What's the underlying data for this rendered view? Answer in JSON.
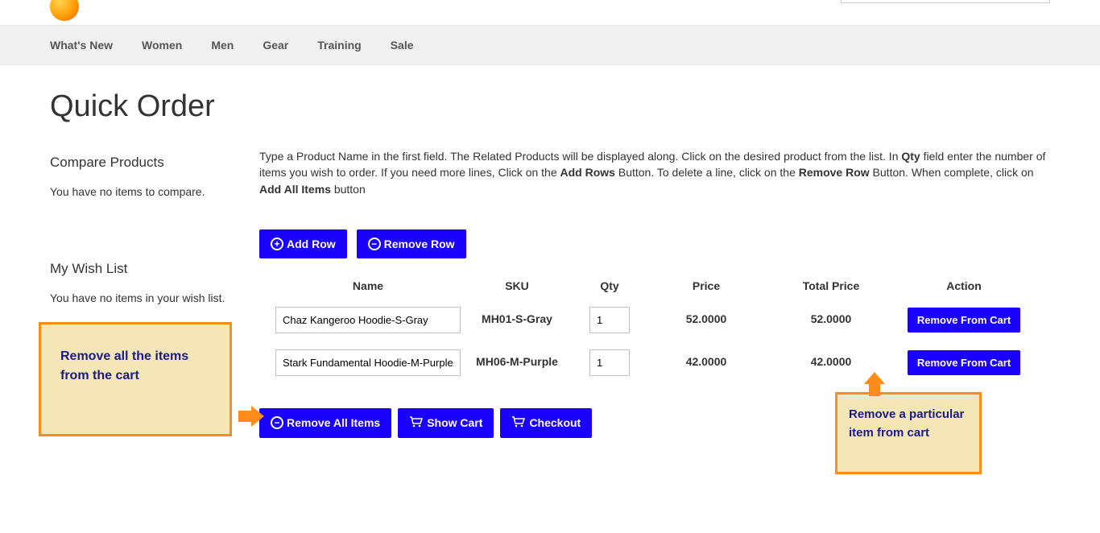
{
  "nav": [
    "What's New",
    "Women",
    "Men",
    "Gear",
    "Training",
    "Sale"
  ],
  "page_title": "Quick Order",
  "sidebar": {
    "compare_title": "Compare Products",
    "compare_empty": "You have no items to compare.",
    "wishlist_title": "My Wish List",
    "wishlist_empty": "You have no items in your wish list."
  },
  "instructions": {
    "p1": "Type a Product Name in the first field. The Related Products will be displayed along. Click on the desired product from the list. In ",
    "b1": "Qty",
    "p2": " field enter the number of items you wish to order. If you need more lines, Click on the ",
    "b2": "Add Rows",
    "p3": " Button. To delete a line, click on the ",
    "b3": "Remove Row",
    "p4": " Button. When complete, click on ",
    "b4": "Add All Items",
    "p5": " button"
  },
  "buttons": {
    "add_row": "Add Row",
    "remove_row": "Remove Row",
    "remove_all": "Remove All Items",
    "show_cart": "Show Cart",
    "checkout": "Checkout",
    "remove_from_cart": "Remove From Cart"
  },
  "table": {
    "headers": {
      "name": "Name",
      "sku": "SKU",
      "qty": "Qty",
      "price": "Price",
      "tprice": "Total Price",
      "action": "Action"
    },
    "rows": [
      {
        "name": "Chaz Kangeroo Hoodie-S-Gray",
        "sku": "MH01-S-Gray",
        "qty": "1",
        "price": "52.0000",
        "tprice": "52.0000"
      },
      {
        "name": "Stark Fundamental Hoodie-M-Purple",
        "sku": "MH06-M-Purple",
        "qty": "1",
        "price": "42.0000",
        "tprice": "42.0000"
      }
    ]
  },
  "callouts": {
    "left": "Remove all the items from the cart",
    "right": "Remove a particular item from cart"
  }
}
